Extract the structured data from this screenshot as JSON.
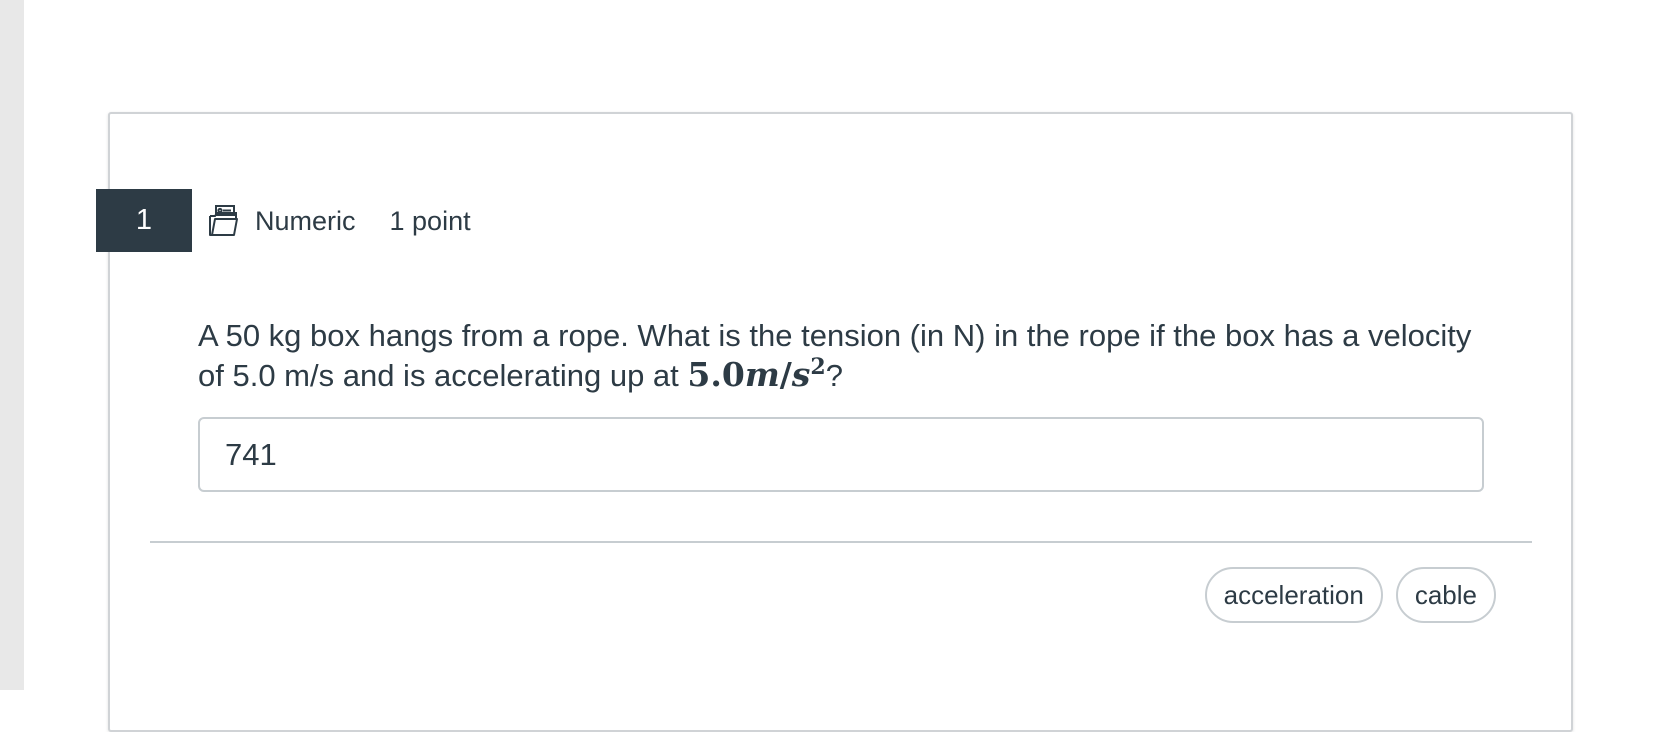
{
  "question": {
    "number": "1",
    "type_icon": "numeric-question-icon",
    "type_label": "Numeric",
    "points": "1 point",
    "text_before_math": "A 50 kg box hangs from a rope. What is the tension (in N) in the rope if the box has a velocity of 5.0 m/s and is accelerating up at ",
    "math": {
      "value": "5.0",
      "unit_m": "m",
      "slash": "/",
      "unit_s": "s",
      "exponent": "2"
    },
    "text_after_math": "?",
    "answer_value": "741"
  },
  "tags": [
    {
      "label": "acceleration"
    },
    {
      "label": "cable"
    }
  ]
}
